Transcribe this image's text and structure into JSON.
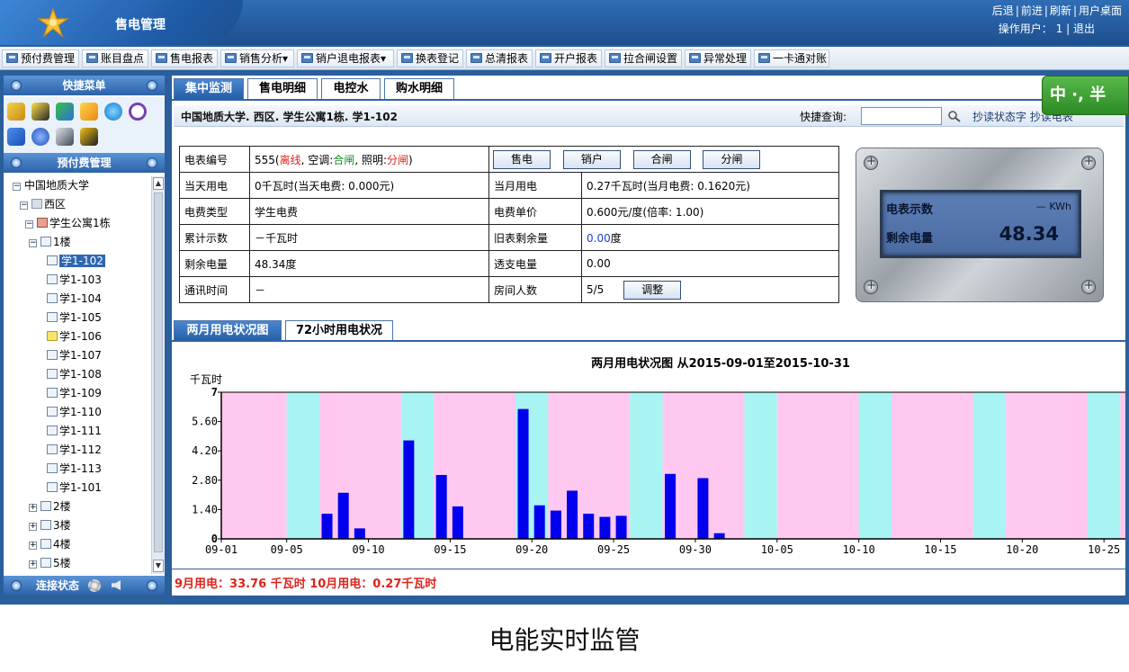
{
  "header": {
    "app_title": "售电管理",
    "links": [
      "后退",
      "前进",
      "刷新",
      "用户桌面"
    ],
    "user_label": "操作用户：",
    "user_value": "1",
    "logout": "退出"
  },
  "toolbar": {
    "items": [
      "预付费管理",
      "账目盘点",
      "售电报表",
      "销售分析▾",
      "销户退电报表▾",
      "换表登记",
      "总清报表",
      "开户报表",
      "拉合闸设置",
      "异常处理",
      "一卡通对账"
    ]
  },
  "sidebar": {
    "quick_menu_title": "快捷菜单",
    "prepay_title": "预付费管理",
    "connection_label": "连接状态",
    "tree": {
      "root": "中国地质大学",
      "district": "西区",
      "building": "学生公寓1栋",
      "floor1": "1楼",
      "rooms": [
        "学1-102",
        "学1-103",
        "学1-104",
        "学1-105",
        "学1-106",
        "学1-107",
        "学1-108",
        "学1-109",
        "学1-110",
        "学1-111",
        "学1-112",
        "学1-113",
        "学1-101"
      ],
      "other_floors": [
        "2楼",
        "3楼",
        "4楼",
        "5楼"
      ]
    }
  },
  "main": {
    "tabs": [
      "集中监测",
      "售电明细",
      "电控水",
      "购水明细"
    ],
    "path": "中国地质大学. 西区. 学生公寓1栋. 学1-102",
    "quick_query_label": "快捷查询:",
    "read_status": "抄读状态字  抄读电表",
    "info": {
      "meter_no_label": "电表编号",
      "meter_no": "555",
      "status_offline": "离线",
      "ac_label": "空调:",
      "ac_state": "合闸",
      "light_label": "照明:",
      "light_state": "分闸",
      "btn_sell": "售电",
      "btn_close_account": "销户",
      "btn_on": "合闸",
      "btn_off": "分闸",
      "today_label": "当天用电",
      "today_value": "0千瓦时(当天电费: 0.000元)",
      "month_label": "当月用电",
      "month_value": "0.27千瓦时(当月电费: 0.1620元)",
      "fee_type_label": "电费类型",
      "fee_type_value": "学生电费",
      "unit_price_label": "电费单价",
      "unit_price_value": "0.600元/度(倍率: 1.00)",
      "cum_label": "累计示数",
      "cum_value": "－千瓦时",
      "old_remain_label": "旧表剩余量",
      "old_remain_num": "0.00",
      "old_remain_unit": "度",
      "remain_label": "剩余电量",
      "remain_value": "48.34度",
      "overdraft_label": "透支电量",
      "overdraft_value": "0.00",
      "comm_label": "通讯时间",
      "comm_value": "－",
      "people_label": "房间人数",
      "people_value": "5/5",
      "btn_adjust": "调整"
    },
    "meter": {
      "reading_label": "电表示数",
      "reading_value": "— KWh",
      "remain_label": "剩余电量",
      "remain_value": "48.34"
    },
    "chart_tabs": [
      "两月用电状况图",
      "72小时用电状况"
    ],
    "summary": "9月用电：33.76 千瓦时  10月用电：0.27千瓦时"
  },
  "ime": "中 ·, 半",
  "caption": "电能实时监管",
  "chart_data": {
    "type": "bar",
    "title": "两月用电状况图  从2015-09-01至2015-10-31",
    "ylabel": "千瓦时",
    "ylim": [
      0,
      7
    ],
    "yticks": [
      "0",
      "1.40",
      "2.80",
      "4.20",
      "5.60",
      "7"
    ],
    "xticks": [
      "09-01",
      "09-05",
      "09-10",
      "09-15",
      "09-20",
      "09-25",
      "09-30",
      "10-05",
      "10-10",
      "10-15",
      "10-20",
      "10-25"
    ],
    "background_bands": [
      "#ffc8f0",
      "#a8f4f2"
    ],
    "bar_color": "#0000ee",
    "x": [
      "09-07",
      "09-08",
      "09-09",
      "09-12",
      "09-14",
      "09-15",
      "09-19",
      "09-20",
      "09-21",
      "09-22",
      "09-23",
      "09-24",
      "09-25",
      "09-28",
      "09-30",
      "10-01"
    ],
    "values": [
      1.2,
      2.2,
      0.5,
      4.7,
      3.05,
      1.55,
      6.2,
      1.6,
      1.35,
      2.3,
      1.2,
      1.05,
      1.1,
      3.1,
      2.9,
      0.27
    ]
  }
}
